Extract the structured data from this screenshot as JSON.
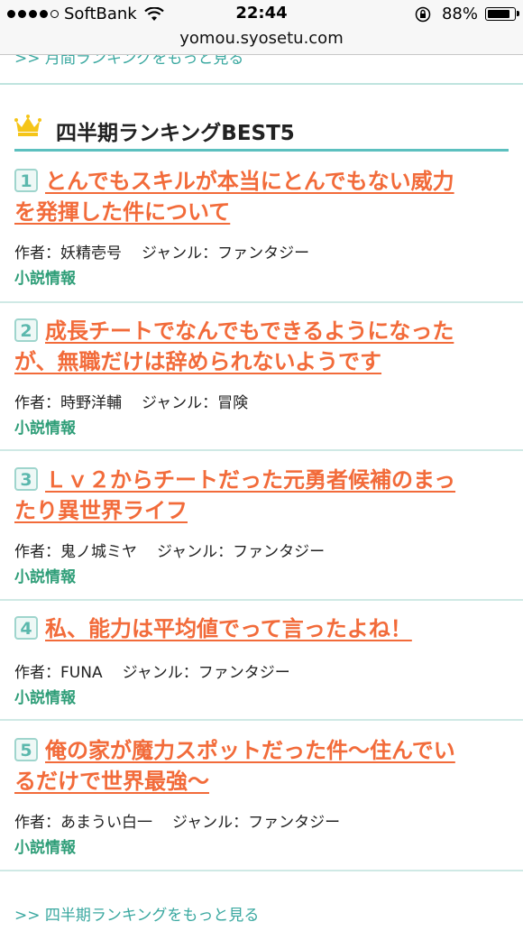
{
  "status_bar": {
    "carrier": "SoftBank",
    "time": "22:44",
    "battery": "88%",
    "battery_level": 0.88,
    "signal_bars_filled": 4,
    "signal_bars_total": 5
  },
  "browser": {
    "url": "yomou.syosetu.com"
  },
  "previous_section": {
    "more_link": ">> 月間ランキングをもっと見る"
  },
  "section": {
    "icon": "crown-icon",
    "title": "四半期ランキングBEST5",
    "accent_color": "#5cc0bf",
    "more_link": ">> 四半期ランキングをもっと見る"
  },
  "rankings": [
    {
      "rank": "1",
      "title_line1": "とんでもスキルが本当にとんでもない威力",
      "title_line2": "を発揮した件について",
      "author_label": "作者：",
      "author": "妖精壱号",
      "genre_label": "ジャンル：",
      "genre": "ファンタジー",
      "info_link": "小説情報"
    },
    {
      "rank": "2",
      "title_line1": "成長チートでなんでもできるようになった",
      "title_line2": "が、無職だけは辞められないようです",
      "author_label": "作者：",
      "author": "時野洋輔",
      "genre_label": "ジャンル：",
      "genre": "冒険",
      "info_link": "小説情報"
    },
    {
      "rank": "3",
      "title_line1": "Ｌｖ２からチートだった元勇者候補のまっ",
      "title_line2": "たり異世界ライフ",
      "author_label": "作者：",
      "author": "鬼ノ城ミヤ",
      "genre_label": "ジャンル：",
      "genre": "ファンタジー",
      "info_link": "小説情報"
    },
    {
      "rank": "4",
      "title_line1": "私、能力は平均値でって言ったよね！",
      "title_line2": "",
      "author_label": "作者：",
      "author": "FUNA",
      "genre_label": "ジャンル：",
      "genre": "ファンタジー",
      "info_link": "小説情報"
    },
    {
      "rank": "5",
      "title_line1": "俺の家が魔力スポットだった件～住んでい",
      "title_line2": "るだけで世界最強～",
      "author_label": "作者：",
      "author": "あまうい白一",
      "genre_label": "ジャンル：",
      "genre": "ファンタジー",
      "info_link": "小説情報"
    }
  ],
  "colors": {
    "title": "#f26b3a",
    "link": "#3aa8a0",
    "info_link": "#2f9e78",
    "separator": "#cfe9e5"
  }
}
